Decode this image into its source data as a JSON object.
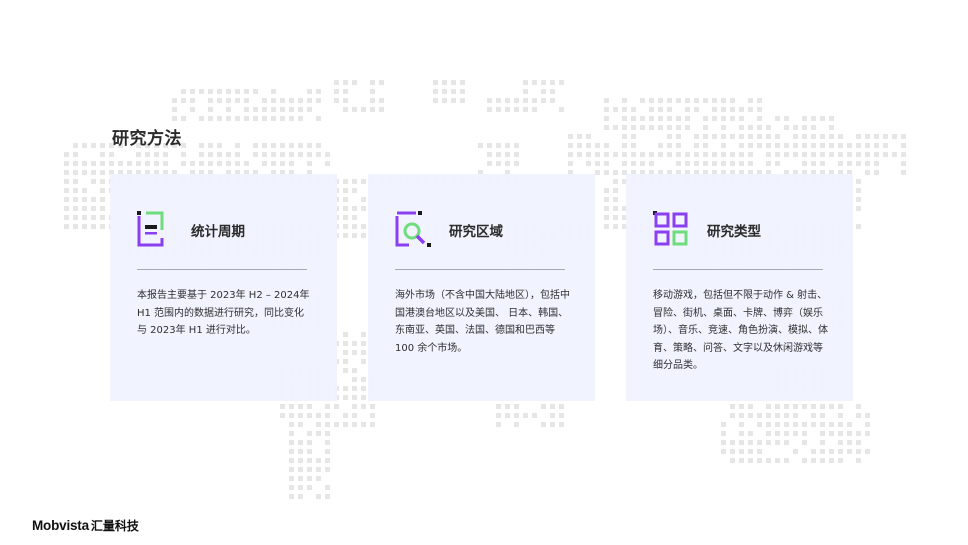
{
  "page": {
    "title": "研究方法"
  },
  "colors": {
    "accent_purple": "#8a3ff0",
    "accent_green": "#6fdc7d",
    "accent_dark": "#1a1a1a",
    "card_bg": "#f0f2ff",
    "map_dot": "#e6e6e6"
  },
  "cards": [
    {
      "icon": "document-icon",
      "title": "统计周期",
      "body": "本报告主要基于 2023年 H2 – 2024年 H1 范围内的数据进行研究，同比变化与 2023年 H1 进行对比。"
    },
    {
      "icon": "magnifier-icon",
      "title": "研究区域",
      "body": "海外市场（不含中国大陆地区），包括中国港澳台地区以及美国、 日本、韩国、东南亚、英国、法国、德国和巴西等 100 余个市场。"
    },
    {
      "icon": "grid-icon",
      "title": "研究类型",
      "body": "移动游戏，包括但不限于动作 & 射击、冒险、街机、桌面、卡牌、博弈（娱乐场）、音乐、竞速、角色扮演、模拟、体育、策略、问答、文字以及休闲游戏等细分品类。"
    }
  ],
  "footer": {
    "logo_en": "Mobvista",
    "logo_cn": "汇量科技"
  }
}
